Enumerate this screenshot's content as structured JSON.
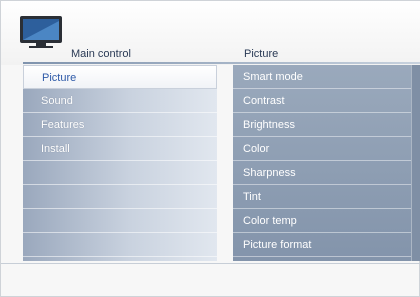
{
  "header": {
    "main_title": "Main control",
    "sub_title": "Picture"
  },
  "left_menu": {
    "items": [
      {
        "label": "Picture",
        "selected": true
      },
      {
        "label": "Sound",
        "selected": false
      },
      {
        "label": "Features",
        "selected": false
      },
      {
        "label": "Install",
        "selected": false
      },
      {
        "label": "",
        "selected": false
      },
      {
        "label": "",
        "selected": false
      },
      {
        "label": "",
        "selected": false
      },
      {
        "label": "",
        "selected": false
      }
    ]
  },
  "picture_menu": {
    "items": [
      {
        "label": "Smart mode"
      },
      {
        "label": "Contrast"
      },
      {
        "label": "Brightness"
      },
      {
        "label": "Color"
      },
      {
        "label": "Sharpness"
      },
      {
        "label": "Tint"
      },
      {
        "label": "Color temp"
      },
      {
        "label": "Picture format"
      }
    ]
  },
  "icons": {
    "header_icon": "tv-icon"
  },
  "colors": {
    "selected_text": "#2e5aa8",
    "panel_blue": "#8394ab",
    "menu_blue": "#9aa8bd"
  }
}
